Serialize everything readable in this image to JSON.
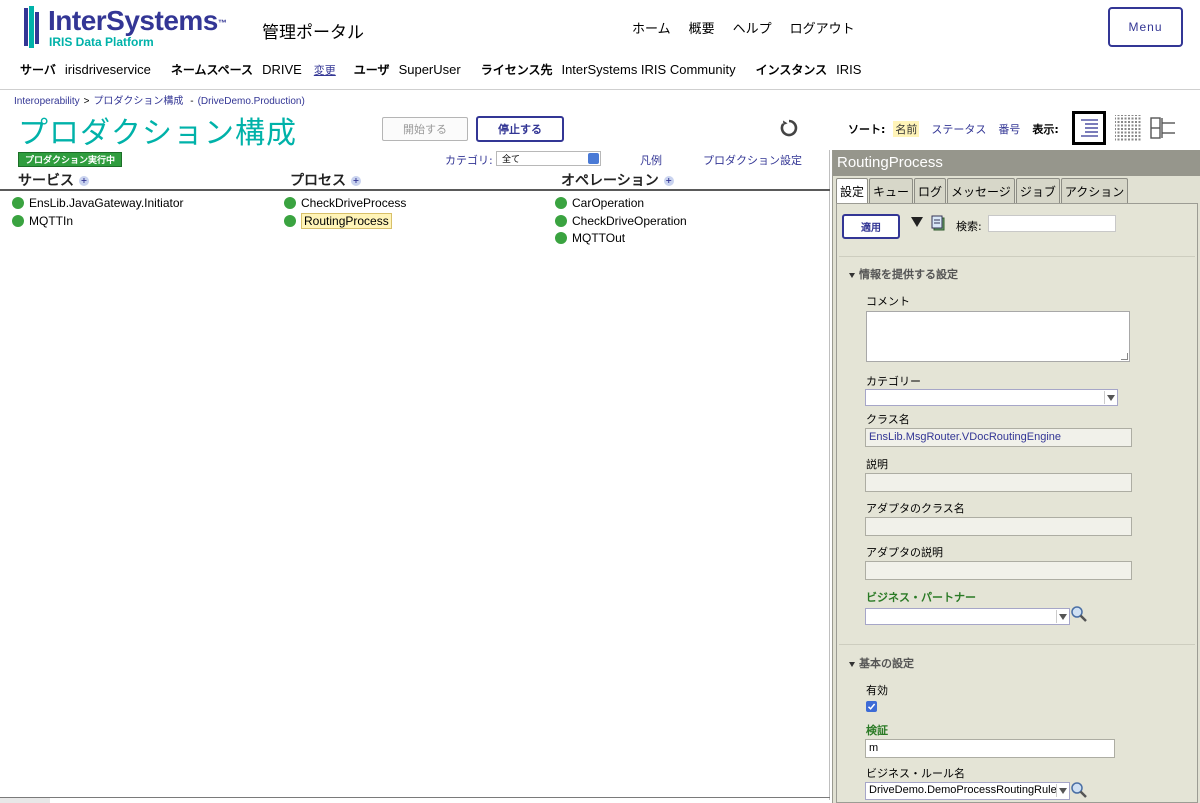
{
  "header": {
    "logo_text": "InterSystems",
    "logo_tm": "™",
    "logo_sub": "IRIS Data Platform",
    "portal_title": "管理ポータル",
    "nav": [
      "ホーム",
      "概要",
      "ヘルプ",
      "ログアウト"
    ],
    "menu_label": "Menu"
  },
  "info": {
    "server_label": "サーバ",
    "server": "irisdriveservice",
    "namespace_label": "ネームスペース",
    "namespace": "DRIVE",
    "change_link": "変更",
    "user_label": "ユーザ",
    "user": "SuperUser",
    "license_label": "ライセンス先",
    "license": "InterSystems IRIS Community",
    "instance_label": "インスタンス",
    "instance": "IRIS"
  },
  "breadcrumb": {
    "root": "Interoperability",
    "sep": ">",
    "page": "プロダクション構成",
    "dash": "-",
    "production": "(DriveDemo.Production)"
  },
  "page_title": "プロダクション構成",
  "actions": {
    "start": "開始する",
    "stop": "停止する"
  },
  "sort": {
    "label": "ソート:",
    "options": [
      "名前",
      "ステータス",
      "番号"
    ],
    "view_label": "表示:"
  },
  "production": {
    "running_badge": "プロダクション実行中",
    "category_label": "カテゴリ:",
    "category_value": "全て",
    "legend_link": "凡例",
    "settings_link": "プロダクション設定",
    "columns": {
      "services": "サービス",
      "processes": "プロセス",
      "operations": "オペレーション"
    },
    "services": [
      "EnsLib.JavaGateway.Initiator",
      "MQTTIn"
    ],
    "processes": [
      "CheckDriveProcess",
      "RoutingProcess"
    ],
    "operations": [
      "CarOperation",
      "CheckDriveOperation",
      "MQTTOut"
    ],
    "status_color": "#3aa340"
  },
  "panel": {
    "title": "RoutingProcess",
    "tabs": [
      "設定",
      "キュー",
      "ログ",
      "メッセージ",
      "ジョブ",
      "アクション"
    ],
    "apply": "適用",
    "search_label": "検索:",
    "section_info": "情報を提供する設定",
    "comment_label": "コメント",
    "category_label": "カテゴリー",
    "class_label": "クラス名",
    "class_value": "EnsLib.MsgRouter.VDocRoutingEngine",
    "desc_label": "説明",
    "adapter_class_label": "アダプタのクラス名",
    "adapter_desc_label": "アダプタの説明",
    "business_partner_label": "ビジネス・パートナー",
    "section_basic": "基本の設定",
    "enabled_label": "有効",
    "validation_label": "検証",
    "validation_value": "m",
    "rule_label": "ビジネス・ルール名",
    "rule_value": "DriveDemo.DemoProcessRoutingRule"
  }
}
